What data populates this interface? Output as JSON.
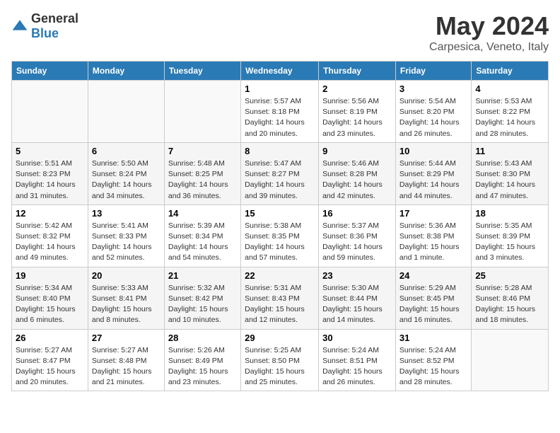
{
  "logo": {
    "general": "General",
    "blue": "Blue"
  },
  "title": "May 2024",
  "location": "Carpesica, Veneto, Italy",
  "headers": [
    "Sunday",
    "Monday",
    "Tuesday",
    "Wednesday",
    "Thursday",
    "Friday",
    "Saturday"
  ],
  "weeks": [
    [
      {
        "day": "",
        "info": ""
      },
      {
        "day": "",
        "info": ""
      },
      {
        "day": "",
        "info": ""
      },
      {
        "day": "1",
        "info": "Sunrise: 5:57 AM\nSunset: 8:18 PM\nDaylight: 14 hours\nand 20 minutes."
      },
      {
        "day": "2",
        "info": "Sunrise: 5:56 AM\nSunset: 8:19 PM\nDaylight: 14 hours\nand 23 minutes."
      },
      {
        "day": "3",
        "info": "Sunrise: 5:54 AM\nSunset: 8:20 PM\nDaylight: 14 hours\nand 26 minutes."
      },
      {
        "day": "4",
        "info": "Sunrise: 5:53 AM\nSunset: 8:22 PM\nDaylight: 14 hours\nand 28 minutes."
      }
    ],
    [
      {
        "day": "5",
        "info": "Sunrise: 5:51 AM\nSunset: 8:23 PM\nDaylight: 14 hours\nand 31 minutes."
      },
      {
        "day": "6",
        "info": "Sunrise: 5:50 AM\nSunset: 8:24 PM\nDaylight: 14 hours\nand 34 minutes."
      },
      {
        "day": "7",
        "info": "Sunrise: 5:48 AM\nSunset: 8:25 PM\nDaylight: 14 hours\nand 36 minutes."
      },
      {
        "day": "8",
        "info": "Sunrise: 5:47 AM\nSunset: 8:27 PM\nDaylight: 14 hours\nand 39 minutes."
      },
      {
        "day": "9",
        "info": "Sunrise: 5:46 AM\nSunset: 8:28 PM\nDaylight: 14 hours\nand 42 minutes."
      },
      {
        "day": "10",
        "info": "Sunrise: 5:44 AM\nSunset: 8:29 PM\nDaylight: 14 hours\nand 44 minutes."
      },
      {
        "day": "11",
        "info": "Sunrise: 5:43 AM\nSunset: 8:30 PM\nDaylight: 14 hours\nand 47 minutes."
      }
    ],
    [
      {
        "day": "12",
        "info": "Sunrise: 5:42 AM\nSunset: 8:32 PM\nDaylight: 14 hours\nand 49 minutes."
      },
      {
        "day": "13",
        "info": "Sunrise: 5:41 AM\nSunset: 8:33 PM\nDaylight: 14 hours\nand 52 minutes."
      },
      {
        "day": "14",
        "info": "Sunrise: 5:39 AM\nSunset: 8:34 PM\nDaylight: 14 hours\nand 54 minutes."
      },
      {
        "day": "15",
        "info": "Sunrise: 5:38 AM\nSunset: 8:35 PM\nDaylight: 14 hours\nand 57 minutes."
      },
      {
        "day": "16",
        "info": "Sunrise: 5:37 AM\nSunset: 8:36 PM\nDaylight: 14 hours\nand 59 minutes."
      },
      {
        "day": "17",
        "info": "Sunrise: 5:36 AM\nSunset: 8:38 PM\nDaylight: 15 hours\nand 1 minute."
      },
      {
        "day": "18",
        "info": "Sunrise: 5:35 AM\nSunset: 8:39 PM\nDaylight: 15 hours\nand 3 minutes."
      }
    ],
    [
      {
        "day": "19",
        "info": "Sunrise: 5:34 AM\nSunset: 8:40 PM\nDaylight: 15 hours\nand 6 minutes."
      },
      {
        "day": "20",
        "info": "Sunrise: 5:33 AM\nSunset: 8:41 PM\nDaylight: 15 hours\nand 8 minutes."
      },
      {
        "day": "21",
        "info": "Sunrise: 5:32 AM\nSunset: 8:42 PM\nDaylight: 15 hours\nand 10 minutes."
      },
      {
        "day": "22",
        "info": "Sunrise: 5:31 AM\nSunset: 8:43 PM\nDaylight: 15 hours\nand 12 minutes."
      },
      {
        "day": "23",
        "info": "Sunrise: 5:30 AM\nSunset: 8:44 PM\nDaylight: 15 hours\nand 14 minutes."
      },
      {
        "day": "24",
        "info": "Sunrise: 5:29 AM\nSunset: 8:45 PM\nDaylight: 15 hours\nand 16 minutes."
      },
      {
        "day": "25",
        "info": "Sunrise: 5:28 AM\nSunset: 8:46 PM\nDaylight: 15 hours\nand 18 minutes."
      }
    ],
    [
      {
        "day": "26",
        "info": "Sunrise: 5:27 AM\nSunset: 8:47 PM\nDaylight: 15 hours\nand 20 minutes."
      },
      {
        "day": "27",
        "info": "Sunrise: 5:27 AM\nSunset: 8:48 PM\nDaylight: 15 hours\nand 21 minutes."
      },
      {
        "day": "28",
        "info": "Sunrise: 5:26 AM\nSunset: 8:49 PM\nDaylight: 15 hours\nand 23 minutes."
      },
      {
        "day": "29",
        "info": "Sunrise: 5:25 AM\nSunset: 8:50 PM\nDaylight: 15 hours\nand 25 minutes."
      },
      {
        "day": "30",
        "info": "Sunrise: 5:24 AM\nSunset: 8:51 PM\nDaylight: 15 hours\nand 26 minutes."
      },
      {
        "day": "31",
        "info": "Sunrise: 5:24 AM\nSunset: 8:52 PM\nDaylight: 15 hours\nand 28 minutes."
      },
      {
        "day": "",
        "info": ""
      }
    ]
  ]
}
